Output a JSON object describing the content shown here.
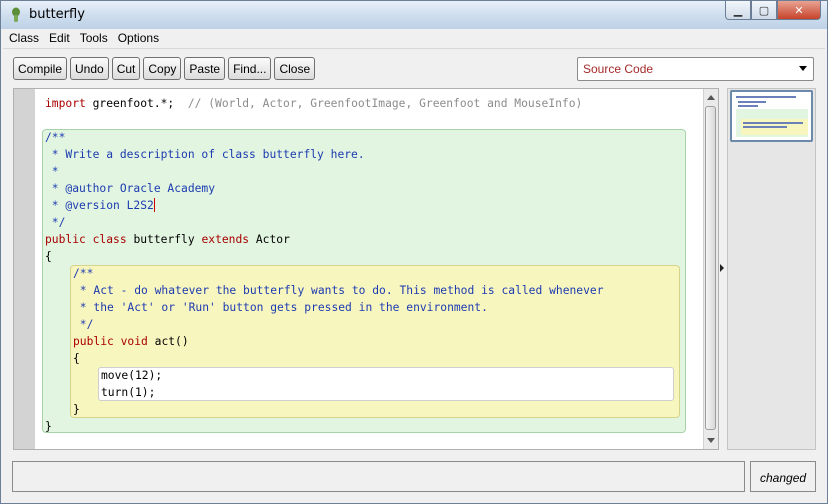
{
  "window": {
    "title": "butterfly"
  },
  "menubar": {
    "items": [
      "Class",
      "Edit",
      "Tools",
      "Options"
    ]
  },
  "toolbar": {
    "buttons": [
      "Compile",
      "Undo",
      "Cut",
      "Copy",
      "Paste",
      "Find...",
      "Close"
    ]
  },
  "view_select": {
    "value": "Source Code"
  },
  "code": {
    "import_kw": "import",
    "import_text": " greenfoot.*;  ",
    "import_comment": "// (World, Actor, GreenfootImage, Greenfoot and MouseInfo)",
    "doc_open": "/**",
    "doc_line1": " * Write a description of class butterfly here.",
    "doc_line2": " *",
    "doc_line3": " * @author Oracle Academy",
    "doc_line4": " * @version L2S2",
    "doc_close": " */",
    "class_public": "public",
    "class_kw": "class",
    "class_name": " butterfly ",
    "class_extends": "extends",
    "class_parent": " Actor",
    "class_open_brace": "{",
    "method_doc_open": "/**",
    "method_doc_line1": " * Act - do whatever the butterfly wants to do. This method is called whenever",
    "method_doc_line2": " * the 'Act' or 'Run' button gets pressed in the environment.",
    "method_doc_close": " */",
    "method_public": "public",
    "method_void": "void",
    "method_name": " act()",
    "method_open_brace": "{",
    "stmt1": "move(12);",
    "stmt2": "turn(1);",
    "method_close_brace": "}",
    "class_close_brace": "}"
  },
  "status": {
    "message": "",
    "state": "changed"
  }
}
